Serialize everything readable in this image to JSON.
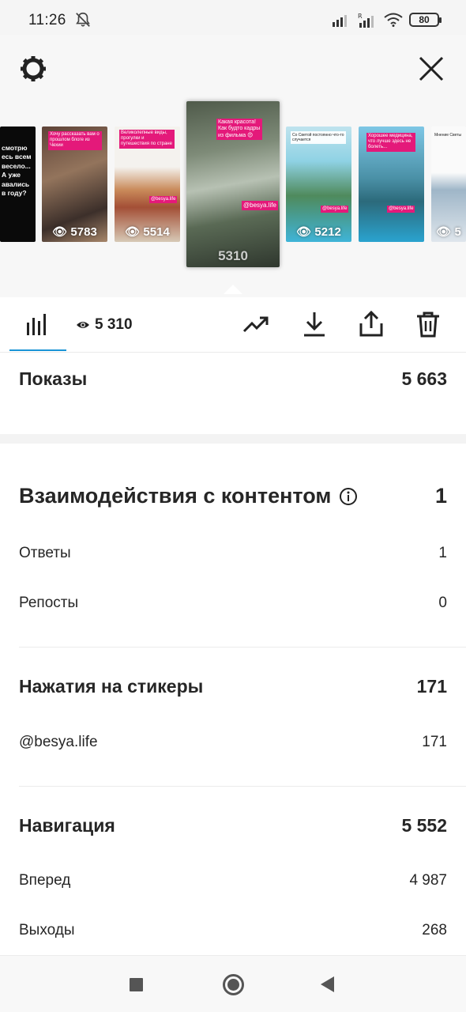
{
  "status_bar": {
    "time": "11:26",
    "battery": "80",
    "icons": [
      "bell-muted-icon",
      "signal-icon",
      "signal-roaming-icon",
      "wifi-icon",
      "battery-icon"
    ]
  },
  "header": {
    "icons": [
      "gear-icon",
      "close-icon"
    ]
  },
  "stories": [
    {
      "text": "смотрю есь всем весело... А уже авались в году?",
      "views": ""
    },
    {
      "text": "Хочу рассказать вам о прошлом блоге из Чехии",
      "views": "5783"
    },
    {
      "text": "Великолепные виды, прогулки и путешествия по стране",
      "tag": "@besya.life",
      "views": "5514"
    },
    {
      "text": "Какая красота! Как будто кадры из фильма 😍",
      "tag": "@besya.life",
      "views": "5310"
    },
    {
      "text": "Со Светой постоянно что-то случается",
      "tag": "@besya.life",
      "views": "5212"
    },
    {
      "text": "Хорошее медицина, что лучше здесь не болеть...",
      "tag": "@besya.life",
      "views": ""
    },
    {
      "text": "Мнение Светы",
      "views": "5"
    }
  ],
  "toolbar": {
    "views": "5 310",
    "icons": [
      "bar-chart-icon",
      "eye-icon",
      "trending-icon",
      "download-icon",
      "share-icon",
      "trash-icon"
    ]
  },
  "impressions": {
    "label": "Показы",
    "value": "5 663"
  },
  "interactions": {
    "title": "Взаимодействия с контентом",
    "value": "1",
    "replies_label": "Ответы",
    "replies_value": "1",
    "reposts_label": "Репосты",
    "reposts_value": "0"
  },
  "stickers": {
    "title": "Нажатия на стикеры",
    "value": "171",
    "item_label": "@besya.life",
    "item_value": "171"
  },
  "navigation": {
    "title": "Навигация",
    "value": "5 552",
    "forward_label": "Вперед",
    "forward_value": "4 987",
    "exits_label": "Выходы",
    "exits_value": "268"
  },
  "colors": {
    "accent": "#1a94d6",
    "text": "#262626",
    "tag_pink": "#e4197a"
  }
}
